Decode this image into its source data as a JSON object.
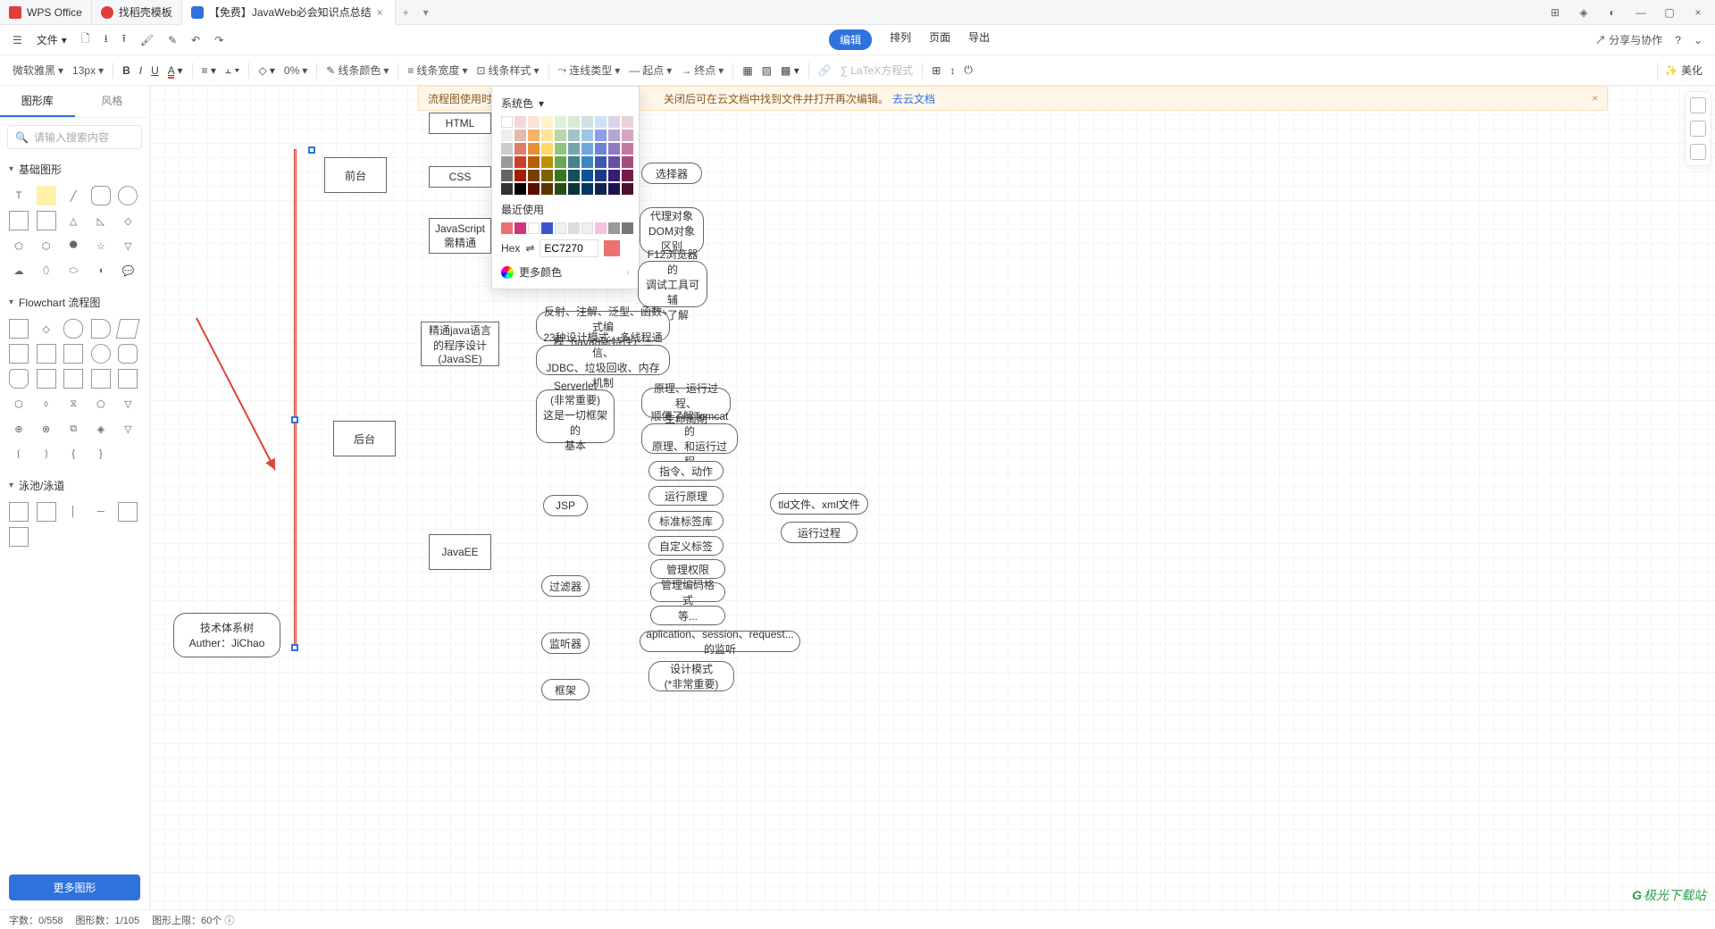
{
  "tabs": {
    "t0": "WPS Office",
    "t1": "找稻壳模板",
    "t2": "【免费】JavaWeb必会知识点总结"
  },
  "filerow": {
    "file": "文件",
    "edit": "编辑",
    "arrange": "排列",
    "page": "页面",
    "export": "导出",
    "share": "分享与协作"
  },
  "fmtbar": {
    "font": "微软雅黑",
    "size": "13px",
    "opacity": "0%",
    "linecolor": "线条颜色",
    "linewidth": "线条宽度",
    "linestyle": "线条样式",
    "linktype": "连线类型",
    "startpoint": "起点",
    "endpoint": "终点",
    "latex": "LaTeX方程式",
    "beautify": "美化"
  },
  "notice": {
    "text_left": "流程图使用时需",
    "text_right": "关闭后可在云文档中找到文件并打开再次编辑。",
    "link": "去云文档"
  },
  "popup": {
    "syscolor": "系统色",
    "recent": "最近使用",
    "hex_label": "Hex",
    "hex_value": "EC7270",
    "more": "更多颜色"
  },
  "left": {
    "tab_lib": "图形库",
    "tab_style": "风格",
    "search_ph": "请输入搜索内容",
    "basic": "基础图形",
    "flowchart": "Flowchart 流程图",
    "swim": "泳池/泳道",
    "more": "更多图形"
  },
  "nodes": {
    "tech": "技术体系树\nAuther：JiChao",
    "front": "前台",
    "back": "后台",
    "html": "HTML",
    "css": "CSS",
    "js": "JavaScript\n需精通",
    "javase": "精通java语言\n的程序设计\n(JavaSE)",
    "serverlet": "Serverlet\n(非常重要)\n这是一切框架的\n基本",
    "javaee": "JavaEE",
    "jsp": "JSP",
    "filter": "过滤器",
    "listener": "监听器",
    "framework": "框架",
    "selector": "选择器",
    "proxy": "代理对象\nDOM对象\n区别",
    "f12": "F12浏览器的\n调试工具可辅\n助了解",
    "reflect": "反射、注解、泛型、函数式编\n程（java8新特性）...",
    "patterns": "23种设计模式、多线程通信、\nJDBC、垃圾回收、内存机制",
    "principle": "原理、运行过程、\n生命周期",
    "tomcat": "顺便了解Tomcat的\n原理、和运行过程",
    "directive": "指令、动作",
    "runprinciple": "运行原理",
    "taglib": "标准标签库",
    "customtag": "自定义标签",
    "tld": "tld文件、xml文件",
    "runprocess": "运行过程",
    "authperm": "管理权限",
    "encodefmt": "管理编码格式",
    "etc": "等...",
    "listeners": "aplication、session、request...的监听",
    "designpattern": "设计模式\n(*非常重要)"
  },
  "status": {
    "words": "字数：0/558",
    "shapes": "图形数：1/105",
    "limit": "图形上限：60个"
  },
  "watermark": "极光下载站",
  "colors": {
    "hex_preview": "#ec7270"
  }
}
